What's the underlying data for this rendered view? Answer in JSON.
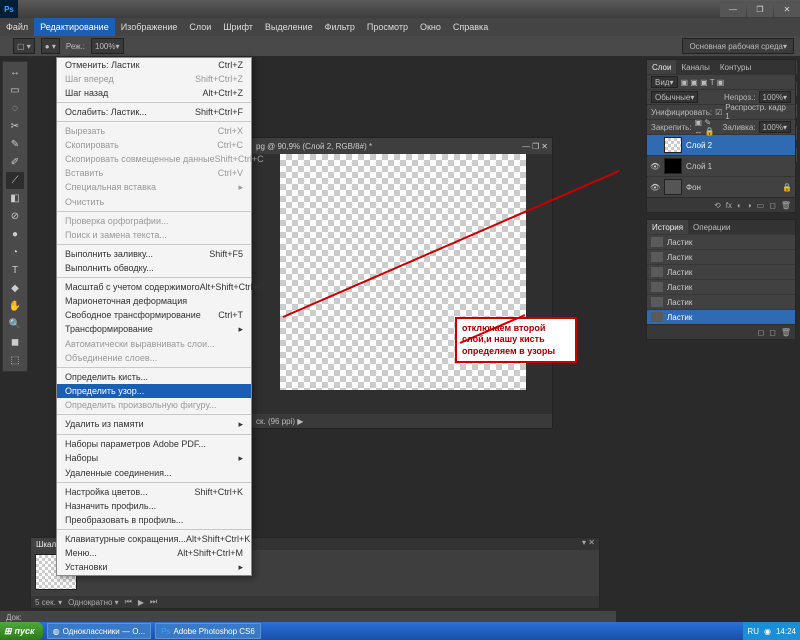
{
  "title": "Adobe Photoshop CS6",
  "menubar": [
    "Файл",
    "Редактирование",
    "Изображение",
    "Слои",
    "Шрифт",
    "Выделение",
    "Фильтр",
    "Просмотр",
    "Окно",
    "Справка"
  ],
  "menubar_active_index": 1,
  "toolbar": {
    "zoom": "100%",
    "workspace": "Основная рабочая среда",
    "mode_label": "Реж.:"
  },
  "edit_menu": [
    {
      "l": "Отменить: Ластик",
      "s": "Ctrl+Z"
    },
    {
      "l": "Шаг вперед",
      "s": "Shift+Ctrl+Z",
      "d": true
    },
    {
      "l": "Шаг назад",
      "s": "Alt+Ctrl+Z"
    },
    "-",
    {
      "l": "Ослабить: Ластик...",
      "s": "Shift+Ctrl+F"
    },
    "-",
    {
      "l": "Вырезать",
      "s": "Ctrl+X",
      "d": true
    },
    {
      "l": "Скопировать",
      "s": "Ctrl+C",
      "d": true
    },
    {
      "l": "Скопировать совмещенные данные",
      "s": "Shift+Ctrl+C",
      "d": true
    },
    {
      "l": "Вставить",
      "s": "Ctrl+V",
      "d": true
    },
    {
      "l": "Специальная вставка",
      "sub": true,
      "d": true
    },
    {
      "l": "Очистить",
      "d": true
    },
    "-",
    {
      "l": "Проверка орфографии...",
      "d": true
    },
    {
      "l": "Поиск и замена текста...",
      "d": true
    },
    "-",
    {
      "l": "Выполнить заливку...",
      "s": "Shift+F5"
    },
    {
      "l": "Выполнить обводку..."
    },
    "-",
    {
      "l": "Масштаб с учетом содержимого",
      "s": "Alt+Shift+Ctrl+C"
    },
    {
      "l": "Марионеточная деформация"
    },
    {
      "l": "Свободное трансформирование",
      "s": "Ctrl+T"
    },
    {
      "l": "Трансформирование",
      "sub": true
    },
    {
      "l": "Автоматически выравнивать слои...",
      "d": true
    },
    {
      "l": "Объединение слоев...",
      "d": true
    },
    "-",
    {
      "l": "Определить кисть..."
    },
    {
      "l": "Определить узор...",
      "hl": true
    },
    {
      "l": "Определить произвольную фигуру...",
      "d": true
    },
    "-",
    {
      "l": "Удалить из памяти",
      "sub": true
    },
    "-",
    {
      "l": "Наборы параметров Adobe PDF..."
    },
    {
      "l": "Наборы",
      "sub": true
    },
    {
      "l": "Удаленные соединения..."
    },
    "-",
    {
      "l": "Настройка цветов...",
      "s": "Shift+Ctrl+K"
    },
    {
      "l": "Назначить профиль..."
    },
    {
      "l": "Преобразовать в профиль..."
    },
    "-",
    {
      "l": "Клавиатурные сокращения...",
      "s": "Alt+Shift+Ctrl+K"
    },
    {
      "l": "Меню...",
      "s": "Alt+Shift+Ctrl+M"
    },
    {
      "l": "Установки",
      "sub": true
    }
  ],
  "doc": {
    "title": "pg @ 90,9% (Слой 2, RGB/8#) *",
    "status": "ск. (96 ppi)  ▶"
  },
  "layers_panel": {
    "tabs": [
      "Слои",
      "Каналы",
      "Контуры"
    ],
    "kind": "Вид",
    "mode": "Обычные",
    "opacity_lbl": "Непроз.:",
    "opacity": "100%",
    "unify_lbl": "Унифицировать:",
    "propagate": "Распростр. кадр 1",
    "lock_lbl": "Закрепить:",
    "fill_lbl": "Заливка:",
    "fill": "100%",
    "items": [
      {
        "name": "Слой 2",
        "eye": false,
        "sel": true,
        "k": "trans"
      },
      {
        "name": "Слой 1",
        "eye": true,
        "k": "black"
      },
      {
        "name": "Фон",
        "eye": true,
        "k": "bg",
        "locked": true
      }
    ]
  },
  "history_panel": {
    "tabs": [
      "История",
      "Операции"
    ],
    "rows": [
      "Ластик",
      "Ластик",
      "Ластик",
      "Ластик",
      "Ластик",
      "Ластик"
    ],
    "sel": 5
  },
  "callout": "отключаем второй слой,и нашу кисть определяем в узоры",
  "timeline": {
    "tab": "Шкала времени",
    "footer": "5 сек. ▾",
    "frame": "Однократно ▾"
  },
  "statusbar": {
    "doc": "Док:"
  },
  "taskbar": {
    "start": "пуск",
    "tasks": [
      "Одноклассники — O...",
      "Adobe Photoshop CS6"
    ],
    "lang": "RU",
    "time": "14:24"
  }
}
